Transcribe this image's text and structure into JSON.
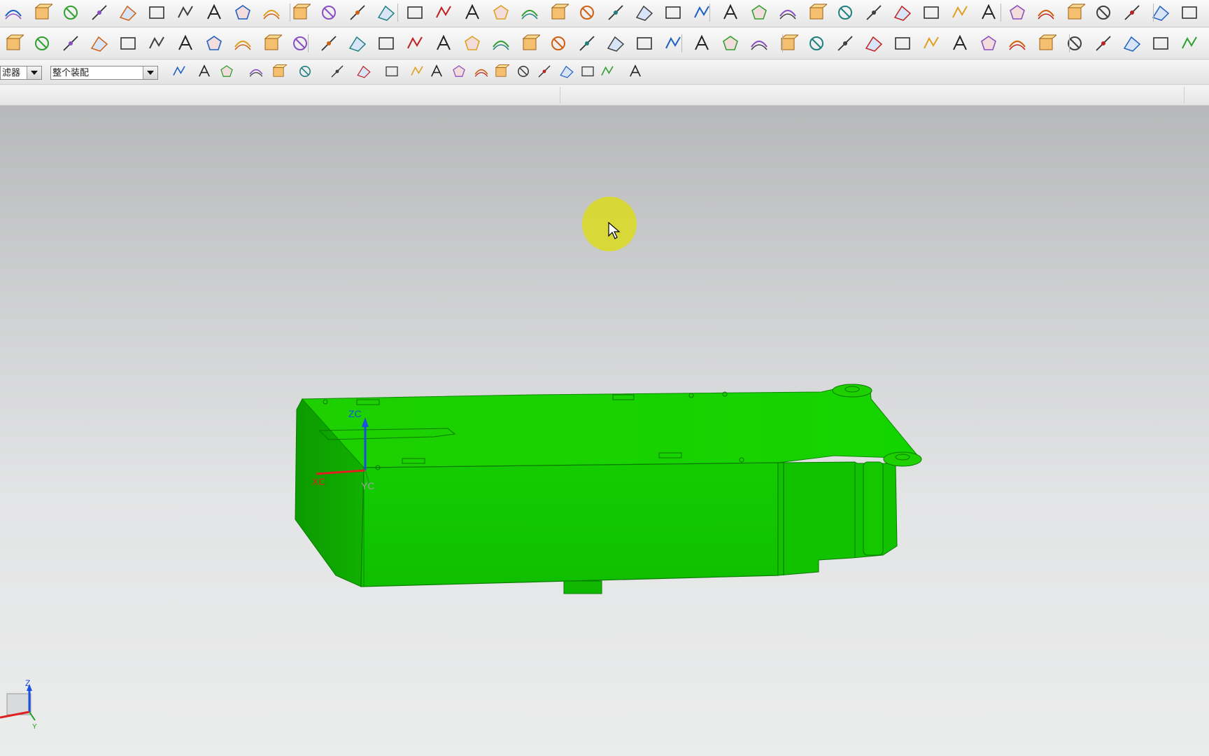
{
  "toolbar": {
    "filter_label": "滤器",
    "assembly_scope_value": "整个装配"
  },
  "model_axes": {
    "x_label": "XC",
    "y_label": "YC",
    "z_label": "ZC"
  },
  "triad": {
    "z_label": "Z",
    "y_label": "Y"
  },
  "colors": {
    "model_green": "#18d000",
    "model_green_dark": "#0c9a00",
    "cursor_highlight": "#dada1e",
    "axis_x": "#e02020",
    "axis_y": "#20a020",
    "axis_z": "#1a50e0"
  },
  "icons": [
    "rectangle-icon",
    "polyline-icon",
    "text-icon",
    "polygon-icon",
    "surface-icon",
    "curve-spline-icon",
    "offset-curve-icon",
    "project-curve-icon",
    "extract-icon",
    "trim-curve-icon",
    "bridge-curve-icon",
    "fillet-curve-icon",
    "section-view-icon",
    "wireframe-icon",
    "measure-distance-icon",
    "point-set-icon",
    "curve-analysis-icon",
    "horizontal-line-icon",
    "draft-analysis-icon",
    "text-box-icon",
    "mesh-icon",
    "angle-icon",
    "shade-icon",
    "surface-grid-icon",
    "surface-mesh-icon",
    "blend-surface-icon",
    "face-analysis-icon",
    "reflection-icon",
    "ruler-icon",
    "cut-icon",
    "hand-icon",
    "cylinder-icon",
    "layer-icon",
    "layer-settings-icon",
    "mold-tool-icon",
    "thicken-icon",
    "color-sphere-icon"
  ]
}
